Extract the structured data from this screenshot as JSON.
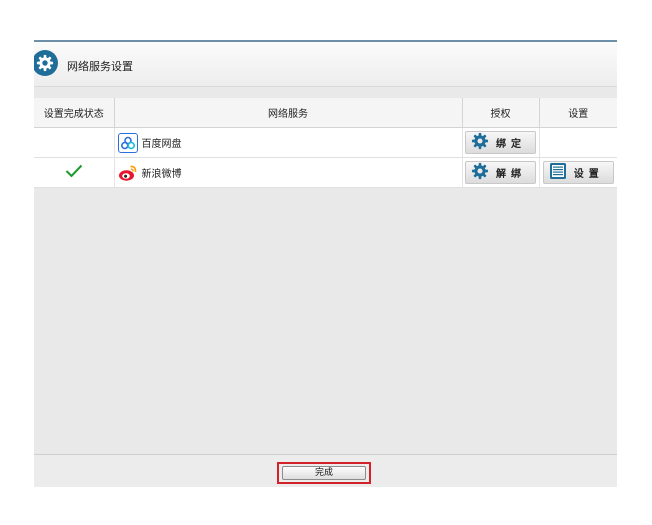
{
  "dialog": {
    "title": "网络服务设置"
  },
  "table": {
    "headers": [
      "设置完成状态",
      "网络服务",
      "授权",
      "设置"
    ],
    "rows": [
      {
        "status": "",
        "service": "百度网盘",
        "service_icon": "baidu-netdisk-icon",
        "auth_label": "绑定",
        "settings_label": ""
      },
      {
        "status": "completed",
        "service": "新浪微博",
        "service_icon": "sina-weibo-icon",
        "auth_label": "解绑",
        "settings_label": "设置"
      }
    ]
  },
  "footer": {
    "done_label": "完成"
  },
  "colors": {
    "accent": "#1f6e99",
    "check": "#1a9a2a",
    "highlight": "#d2232a"
  }
}
